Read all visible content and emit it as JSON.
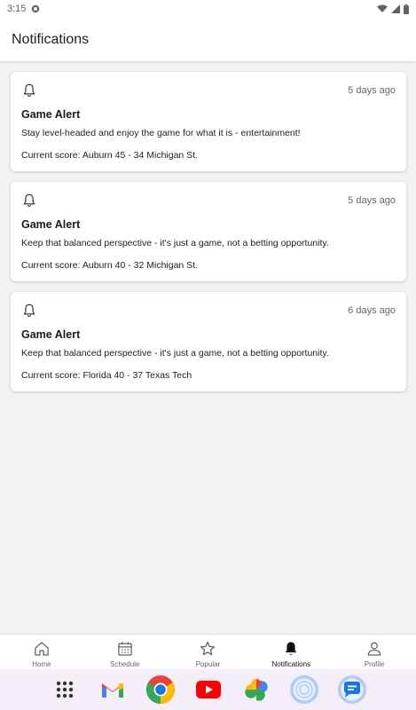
{
  "status_bar": {
    "time": "3:15"
  },
  "app_bar": {
    "title": "Notifications"
  },
  "notifications": [
    {
      "title": "Game Alert",
      "time_ago": "5 days ago",
      "message": "Stay level-headed and enjoy the game for what it is - entertainment!",
      "score": "Current score: Auburn 45 - 34 Michigan St."
    },
    {
      "title": "Game Alert",
      "time_ago": "5 days ago",
      "message": "Keep that balanced perspective - it's just a game, not a betting opportunity.",
      "score": "Current score: Auburn 40 - 32 Michigan St."
    },
    {
      "title": "Game Alert",
      "time_ago": "6 days ago",
      "message": "Keep that balanced perspective - it's just a game, not a betting opportunity.",
      "score": "Current score: Florida 40 - 37 Texas Tech"
    }
  ],
  "bottom_nav": {
    "items": [
      {
        "label": "Home",
        "icon": "home-icon"
      },
      {
        "label": "Schedule",
        "icon": "calendar-icon"
      },
      {
        "label": "Popular",
        "icon": "star-icon"
      },
      {
        "label": "Notifications",
        "icon": "bell-icon",
        "active": true
      },
      {
        "label": "Profile",
        "icon": "person-icon"
      }
    ]
  },
  "dock": {
    "apps": [
      "app-drawer-icon",
      "gmail-icon",
      "chrome-icon",
      "youtube-icon",
      "photos-icon",
      "camera-icon",
      "messages-icon"
    ]
  },
  "colors": {
    "background": "#f2f2f2",
    "card": "#ffffff",
    "dock": "#f3eef8"
  }
}
